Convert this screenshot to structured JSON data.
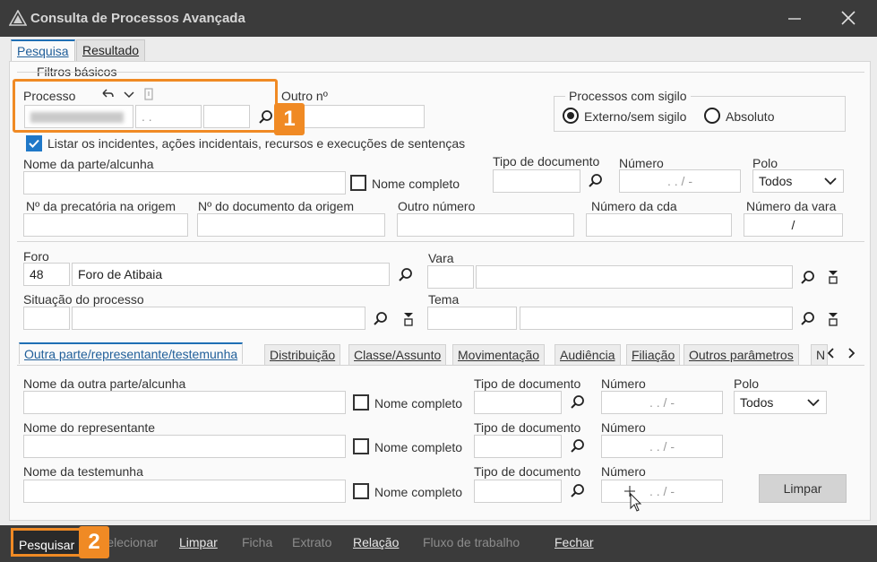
{
  "window": {
    "title": "Consulta de Processos Avançada"
  },
  "top_tabs": [
    "Pesquisa",
    "Resultado"
  ],
  "filtros": {
    "legend": "Filtros básicos",
    "processo_label": "Processo",
    "processo_seg2": ". .",
    "outro_no_label": "Outro nº",
    "sigilo_legend": "Processos com sigilo",
    "radio_externo": "Externo/sem sigilo",
    "radio_absoluto": "Absoluto",
    "listar_label": "Listar os incidentes, ações incidentais, recursos e execuções de sentenças",
    "nome_parte_label": "Nome da parte/alcunha",
    "nome_completo": "Nome completo",
    "tipo_doc_label": "Tipo de documento",
    "numero_label": "Número",
    "numero_mask": ". . /  -",
    "polo_label": "Polo",
    "polo_value": "Todos",
    "precatoria_label": "Nº da precatória na origem",
    "doc_origem_label": "Nº do documento da origem",
    "outro_numero_label": "Outro número",
    "numero_cda_label": "Número da cda",
    "numero_vara_label": "Número da vara",
    "numero_vara_mask": "/",
    "foro_label": "Foro",
    "foro_code": "48",
    "foro_name": "Foro de Atibaia",
    "vara_label": "Vara",
    "situacao_label": "Situação do processo",
    "tema_label": "Tema"
  },
  "mid_tabs": [
    "Outra parte/representante/testemunha",
    "Distribuição",
    "Classe/Assunto",
    "Movimentação",
    "Audiência",
    "Filiação",
    "Outros parâmetros",
    "N"
  ],
  "outra_parte": {
    "nome_outra_label": "Nome da outra parte/alcunha",
    "nome_repr_label": "Nome do representante",
    "nome_test_label": "Nome da testemunha",
    "nome_completo": "Nome completo",
    "tipo_doc_label": "Tipo de documento",
    "numero_label": "Número",
    "numero_mask": ". . /  -",
    "polo_label": "Polo",
    "polo_value": "Todos",
    "limpar": "Limpar"
  },
  "callouts": [
    "1",
    "2"
  ],
  "bottom": {
    "pesquisar": "Pesquisar",
    "selecionar": "Selecionar",
    "limpar": "Limpar",
    "ficha": "Ficha",
    "extrato": "Extrato",
    "relacao": "Relação",
    "fluxo": "Fluxo de trabalho",
    "fechar": "Fechar"
  },
  "colors": {
    "accent": "#f08a24",
    "check": "#1f78c8",
    "titlebar": "#3b3b3b"
  }
}
